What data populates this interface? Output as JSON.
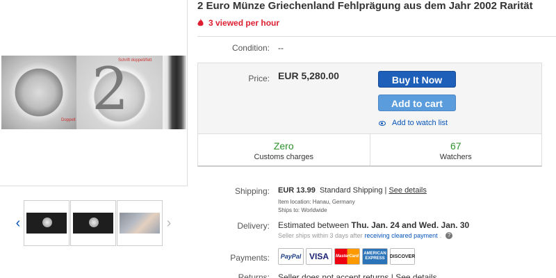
{
  "listing": {
    "title": "2 Euro Münze Griechenland Fehlprägung aus dem Jahr 2002  Rarität",
    "viewed": "3 viewed per hour"
  },
  "image": {
    "annotations": [
      "Schrift doppelt/fett",
      "Doppelt"
    ],
    "thumbnails": [
      "coin-front-thumb",
      "coin-back-thumb",
      "hand-coin-thumb"
    ]
  },
  "condition": {
    "label": "Condition:",
    "value": "--"
  },
  "price": {
    "label": "Price:",
    "value": "EUR 5,280.00",
    "buy_now": "Buy It Now",
    "add_to_cart": "Add to cart",
    "watch": "Add to watch list"
  },
  "stats": [
    {
      "value": "Zero",
      "caption": "Customs charges"
    },
    {
      "value": "67",
      "caption": "Watchers"
    }
  ],
  "shipping": {
    "label": "Shipping:",
    "cost": "EUR 13.99",
    "method": "Standard Shipping |",
    "details_link": "See details",
    "location": "Item location:  Hanau, Germany",
    "ships_to": "Ships to:  Worldwide"
  },
  "delivery": {
    "label": "Delivery:",
    "prefix": "Estimated between",
    "range": "Thu. Jan. 24 and Wed. Jan. 30",
    "sub": "Seller ships within 3 days after",
    "sub_link": "receiving cleared payment",
    "sub_end": ".",
    "help": "?"
  },
  "payments": {
    "label": "Payments:",
    "logos": [
      "PayPal",
      "VISA",
      "MasterCard",
      "AMERICAN EXPRESS",
      "DISCOVER"
    ]
  },
  "returns": {
    "label": "Returns:",
    "text": "Seller does not accept returns |",
    "link": "See details"
  },
  "colors": {
    "accent": "#0654ba",
    "buy_button": "#1d5fb9",
    "cart_button": "#5a9cdc",
    "watchers_green": "#2c8f2c",
    "viewed_red": "#dd1e31"
  }
}
